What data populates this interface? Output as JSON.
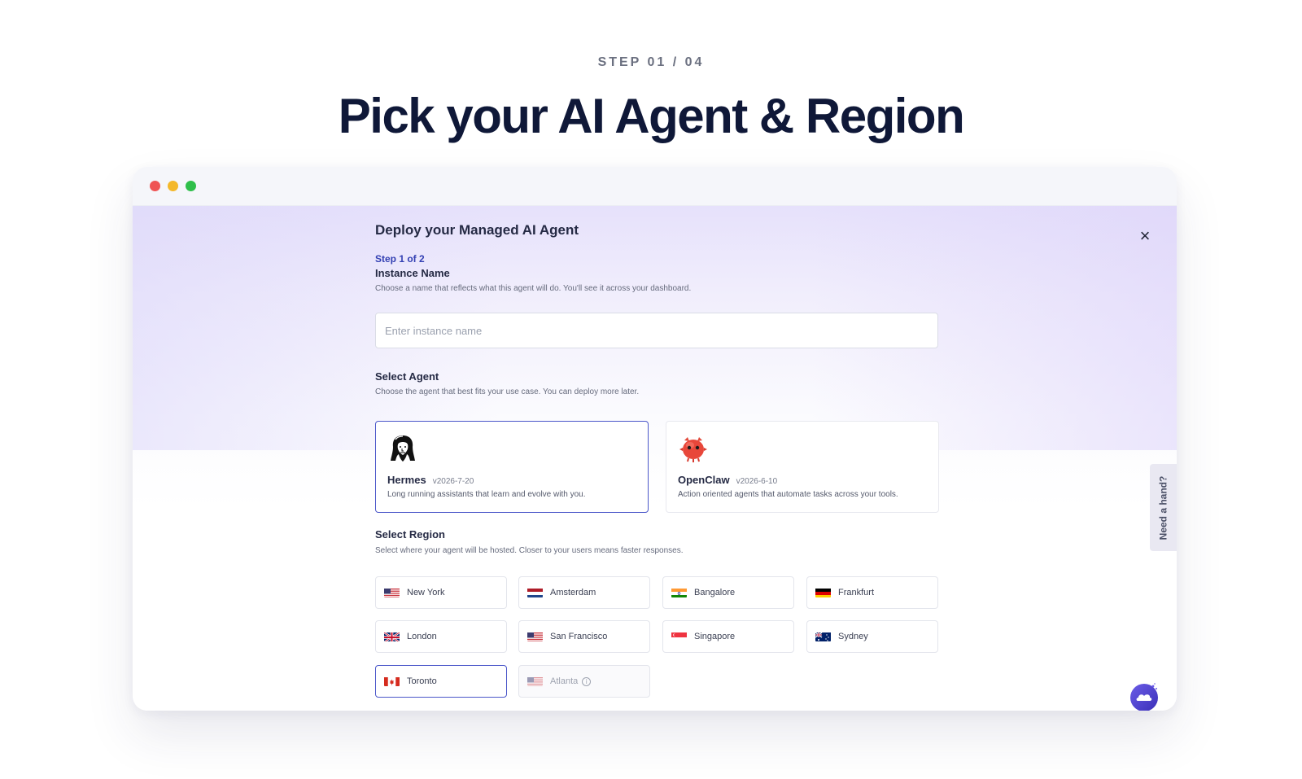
{
  "hero": {
    "step_label": "STEP 01 / 04",
    "title": "Pick your AI Agent & Region"
  },
  "window_controls": [
    "close",
    "minimize",
    "maximize"
  ],
  "dialog": {
    "title": "Deploy your Managed AI Agent",
    "close_icon": "×",
    "step_indicator": "Step 1 of 2",
    "instance": {
      "title": "Instance Name",
      "description": "Choose a name that reflects what this agent will do. You'll see it across your dashboard.",
      "placeholder": "Enter instance name",
      "value": ""
    },
    "agent": {
      "title": "Select Agent",
      "description": "Choose the agent that best fits your use case. You can deploy more later.",
      "options": [
        {
          "name": "Hermes",
          "version": "v2026-7-20",
          "description": "Long running assistants that learn and evolve with you.",
          "icon": "hermes-bust-icon",
          "selected": true
        },
        {
          "name": "OpenClaw",
          "version": "v2026-6-10",
          "description": "Action oriented agents that automate tasks across your tools.",
          "icon": "openclaw-crab-icon",
          "selected": false
        }
      ]
    },
    "region": {
      "title": "Select Region",
      "description": "Select where your agent will be hosted. Closer to your users means faster responses.",
      "options": [
        {
          "label": "New York",
          "flag": "us-flag-icon",
          "selected": false,
          "disabled": false
        },
        {
          "label": "Amsterdam",
          "flag": "nl-flag-icon",
          "selected": false,
          "disabled": false
        },
        {
          "label": "Bangalore",
          "flag": "in-flag-icon",
          "selected": false,
          "disabled": false
        },
        {
          "label": "Frankfurt",
          "flag": "de-flag-icon",
          "selected": false,
          "disabled": false
        },
        {
          "label": "London",
          "flag": "uk-flag-icon",
          "selected": false,
          "disabled": false
        },
        {
          "label": "San Francisco",
          "flag": "us-flag-icon",
          "selected": false,
          "disabled": false
        },
        {
          "label": "Singapore",
          "flag": "sg-flag-icon",
          "selected": false,
          "disabled": false
        },
        {
          "label": "Sydney",
          "flag": "au-flag-icon",
          "selected": false,
          "disabled": false
        },
        {
          "label": "Toronto",
          "flag": "ca-flag-icon",
          "selected": true,
          "disabled": false
        },
        {
          "label": "Atlanta",
          "flag": "us-flag-icon",
          "selected": false,
          "disabled": true
        }
      ]
    }
  },
  "help_tab": {
    "label": "Need a hand?"
  },
  "chat_widget": {
    "icon": "cloud-chat-icon"
  },
  "colors": {
    "accent": "#4b57c9",
    "step_indicator": "#3340b3",
    "hero_title": "#0f1838"
  }
}
